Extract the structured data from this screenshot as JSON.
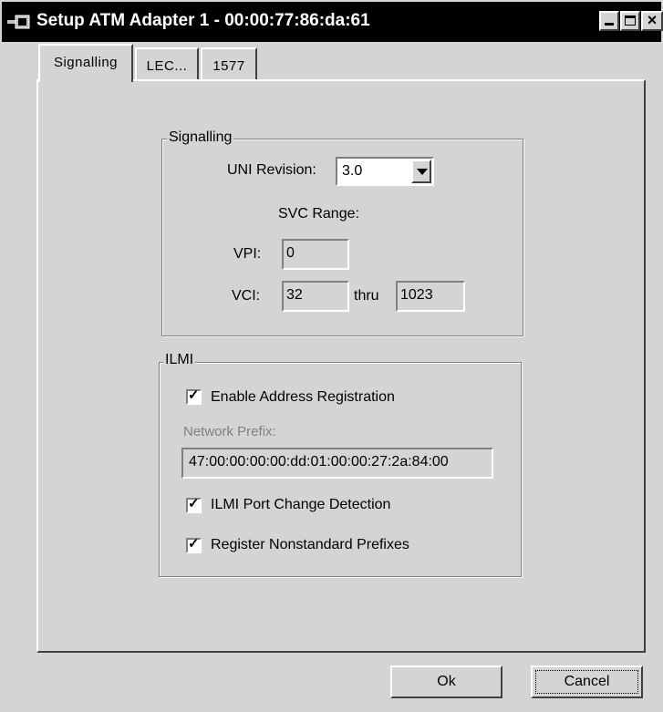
{
  "window": {
    "title": "Setup ATM Adapter 1 - 00:00:77:86:da:61",
    "icon": "network-adapter-icon"
  },
  "tabs": [
    {
      "label": "Signalling",
      "active": true
    },
    {
      "label": "LEC...",
      "active": false
    },
    {
      "label": "1577",
      "active": false
    }
  ],
  "signalling": {
    "group_title": "Signalling",
    "uni_revision_label": "UNI Revision:",
    "uni_revision_value": "3.0",
    "svc_range_label": "SVC Range:",
    "vpi_label": "VPI:",
    "vpi_value": "0",
    "vci_label": "VCI:",
    "vci_from": "32",
    "thru_label": "thru",
    "vci_to": "1023"
  },
  "ilmi": {
    "group_title": "ILMI",
    "enable_address_registration": {
      "label": "Enable Address Registration",
      "checked": true
    },
    "network_prefix_label": "Network Prefix:",
    "network_prefix_value": "47:00:00:00:00:dd:01:00:00:27:2a:84:00",
    "port_change_detection": {
      "label": "ILMI Port Change Detection",
      "checked": true
    },
    "register_nonstandard_prefixes": {
      "label": "Register Nonstandard Prefixes",
      "checked": true
    }
  },
  "buttons": {
    "ok": "Ok",
    "cancel": "Cancel"
  }
}
